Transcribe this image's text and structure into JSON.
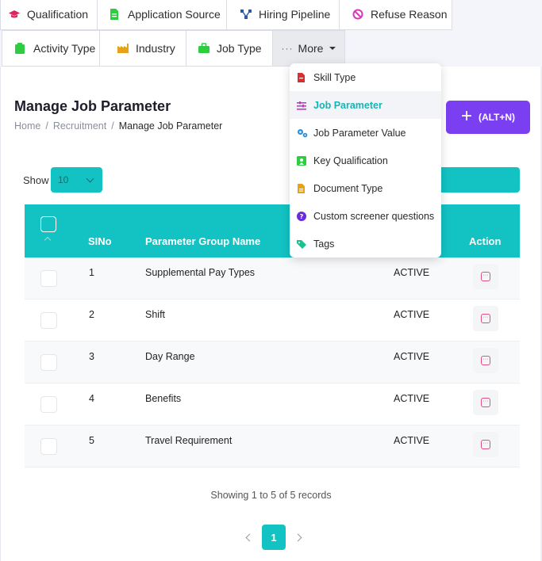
{
  "tabs_row1": [
    {
      "label": "Qualification",
      "icon": "graduation-cap-icon",
      "color": "#e0245e"
    },
    {
      "label": "Application Source",
      "icon": "file-icon",
      "color": "#2ecc40"
    },
    {
      "label": "Hiring Pipeline",
      "icon": "pipeline-icon",
      "color": "#2c5aa0"
    },
    {
      "label": "Refuse Reason",
      "icon": "ban-icon",
      "color": "#d63ab8"
    }
  ],
  "tabs_row2": [
    {
      "label": "Activity Type",
      "icon": "clipboard-icon",
      "color": "#2ecc40"
    },
    {
      "label": "Industry",
      "icon": "industry-icon",
      "color": "#e6a219"
    },
    {
      "label": "Job Type",
      "icon": "briefcase-icon",
      "color": "#2ecc40"
    }
  ],
  "more_tab": {
    "label": "More",
    "dots": "···"
  },
  "dropdown": [
    {
      "label": "Skill Type",
      "icon": "file-icon",
      "color": "#d63031",
      "active": false
    },
    {
      "label": "Job Parameter",
      "icon": "sliders-icon",
      "color": "#c23ac8",
      "active": true
    },
    {
      "label": "Job Parameter Value",
      "icon": "cogs-icon",
      "color": "#2c8fd6",
      "active": false
    },
    {
      "label": "Key Qualification",
      "icon": "certificate-icon",
      "color": "#2ecc40",
      "active": false
    },
    {
      "label": "Document Type",
      "icon": "file-icon",
      "color": "#e6a219",
      "active": false
    },
    {
      "label": "Custom screener questions",
      "icon": "question-circle-icon",
      "color": "#6c2bd9",
      "active": false
    },
    {
      "label": "Tags",
      "icon": "tags-icon",
      "color": "#1fbf8f",
      "active": false
    }
  ],
  "page": {
    "title": "Manage Job Parameter",
    "breadcrumb": [
      "Home",
      "/",
      "Recruitment",
      "/",
      "Manage Job Parameter"
    ],
    "add_button": "(ALT+N)",
    "add_plus": "+",
    "show_label": "Show",
    "show_value": "10"
  },
  "table": {
    "headers": {
      "sino": "SINo",
      "name": "Parameter Group Name",
      "action": "Action"
    },
    "rows": [
      {
        "sino": "1",
        "name": "Supplemental Pay Types",
        "status": "ACTIVE"
      },
      {
        "sino": "2",
        "name": "Shift",
        "status": "ACTIVE"
      },
      {
        "sino": "3",
        "name": "Day Range",
        "status": "ACTIVE"
      },
      {
        "sino": "4",
        "name": "Benefits",
        "status": "ACTIVE"
      },
      {
        "sino": "5",
        "name": "Travel Requirement",
        "status": "ACTIVE"
      }
    ]
  },
  "summary": "Showing 1 to 5 of 5 records",
  "pagination": {
    "current": "1"
  },
  "colors": {
    "accent": "#13c2c2",
    "primary_button": "#7b3ff2",
    "action_icon": "#e0507a"
  }
}
